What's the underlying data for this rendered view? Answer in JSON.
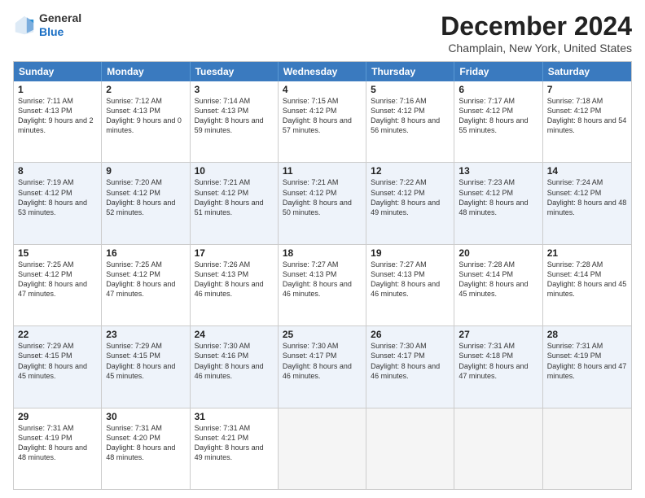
{
  "header": {
    "logo": {
      "general": "General",
      "blue": "Blue"
    },
    "title": "December 2024",
    "location": "Champlain, New York, United States"
  },
  "weekdays": [
    "Sunday",
    "Monday",
    "Tuesday",
    "Wednesday",
    "Thursday",
    "Friday",
    "Saturday"
  ],
  "rows": [
    [
      {
        "day": "1",
        "sunrise": "7:11 AM",
        "sunset": "4:13 PM",
        "daylight": "9 hours and 2 minutes."
      },
      {
        "day": "2",
        "sunrise": "7:12 AM",
        "sunset": "4:13 PM",
        "daylight": "9 hours and 0 minutes."
      },
      {
        "day": "3",
        "sunrise": "7:14 AM",
        "sunset": "4:13 PM",
        "daylight": "8 hours and 59 minutes."
      },
      {
        "day": "4",
        "sunrise": "7:15 AM",
        "sunset": "4:12 PM",
        "daylight": "8 hours and 57 minutes."
      },
      {
        "day": "5",
        "sunrise": "7:16 AM",
        "sunset": "4:12 PM",
        "daylight": "8 hours and 56 minutes."
      },
      {
        "day": "6",
        "sunrise": "7:17 AM",
        "sunset": "4:12 PM",
        "daylight": "8 hours and 55 minutes."
      },
      {
        "day": "7",
        "sunrise": "7:18 AM",
        "sunset": "4:12 PM",
        "daylight": "8 hours and 54 minutes."
      }
    ],
    [
      {
        "day": "8",
        "sunrise": "7:19 AM",
        "sunset": "4:12 PM",
        "daylight": "8 hours and 53 minutes."
      },
      {
        "day": "9",
        "sunrise": "7:20 AM",
        "sunset": "4:12 PM",
        "daylight": "8 hours and 52 minutes."
      },
      {
        "day": "10",
        "sunrise": "7:21 AM",
        "sunset": "4:12 PM",
        "daylight": "8 hours and 51 minutes."
      },
      {
        "day": "11",
        "sunrise": "7:21 AM",
        "sunset": "4:12 PM",
        "daylight": "8 hours and 50 minutes."
      },
      {
        "day": "12",
        "sunrise": "7:22 AM",
        "sunset": "4:12 PM",
        "daylight": "8 hours and 49 minutes."
      },
      {
        "day": "13",
        "sunrise": "7:23 AM",
        "sunset": "4:12 PM",
        "daylight": "8 hours and 48 minutes."
      },
      {
        "day": "14",
        "sunrise": "7:24 AM",
        "sunset": "4:12 PM",
        "daylight": "8 hours and 48 minutes."
      }
    ],
    [
      {
        "day": "15",
        "sunrise": "7:25 AM",
        "sunset": "4:12 PM",
        "daylight": "8 hours and 47 minutes."
      },
      {
        "day": "16",
        "sunrise": "7:25 AM",
        "sunset": "4:12 PM",
        "daylight": "8 hours and 47 minutes."
      },
      {
        "day": "17",
        "sunrise": "7:26 AM",
        "sunset": "4:13 PM",
        "daylight": "8 hours and 46 minutes."
      },
      {
        "day": "18",
        "sunrise": "7:27 AM",
        "sunset": "4:13 PM",
        "daylight": "8 hours and 46 minutes."
      },
      {
        "day": "19",
        "sunrise": "7:27 AM",
        "sunset": "4:13 PM",
        "daylight": "8 hours and 46 minutes."
      },
      {
        "day": "20",
        "sunrise": "7:28 AM",
        "sunset": "4:14 PM",
        "daylight": "8 hours and 45 minutes."
      },
      {
        "day": "21",
        "sunrise": "7:28 AM",
        "sunset": "4:14 PM",
        "daylight": "8 hours and 45 minutes."
      }
    ],
    [
      {
        "day": "22",
        "sunrise": "7:29 AM",
        "sunset": "4:15 PM",
        "daylight": "8 hours and 45 minutes."
      },
      {
        "day": "23",
        "sunrise": "7:29 AM",
        "sunset": "4:15 PM",
        "daylight": "8 hours and 45 minutes."
      },
      {
        "day": "24",
        "sunrise": "7:30 AM",
        "sunset": "4:16 PM",
        "daylight": "8 hours and 46 minutes."
      },
      {
        "day": "25",
        "sunrise": "7:30 AM",
        "sunset": "4:17 PM",
        "daylight": "8 hours and 46 minutes."
      },
      {
        "day": "26",
        "sunrise": "7:30 AM",
        "sunset": "4:17 PM",
        "daylight": "8 hours and 46 minutes."
      },
      {
        "day": "27",
        "sunrise": "7:31 AM",
        "sunset": "4:18 PM",
        "daylight": "8 hours and 47 minutes."
      },
      {
        "day": "28",
        "sunrise": "7:31 AM",
        "sunset": "4:19 PM",
        "daylight": "8 hours and 47 minutes."
      }
    ],
    [
      {
        "day": "29",
        "sunrise": "7:31 AM",
        "sunset": "4:19 PM",
        "daylight": "8 hours and 48 minutes."
      },
      {
        "day": "30",
        "sunrise": "7:31 AM",
        "sunset": "4:20 PM",
        "daylight": "8 hours and 48 minutes."
      },
      {
        "day": "31",
        "sunrise": "7:31 AM",
        "sunset": "4:21 PM",
        "daylight": "8 hours and 49 minutes."
      },
      null,
      null,
      null,
      null
    ]
  ]
}
